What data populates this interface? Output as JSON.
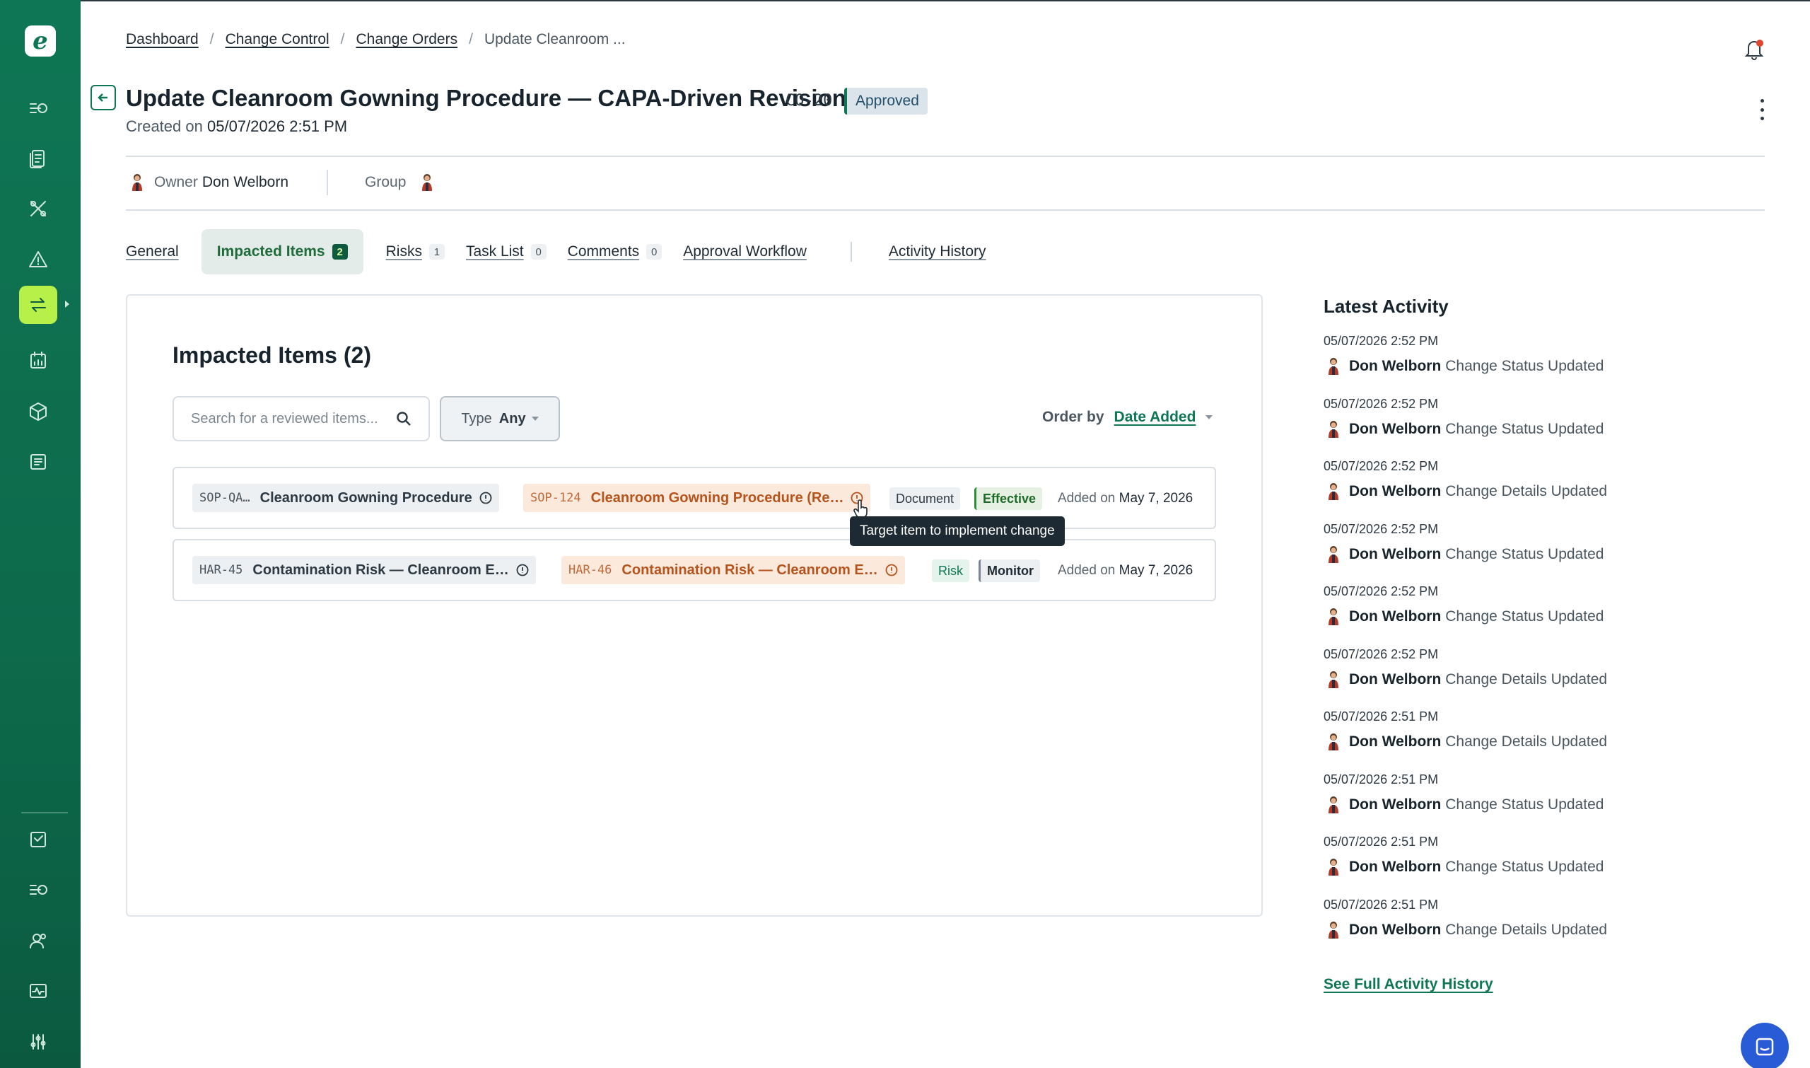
{
  "sidebar": {
    "logo": "e",
    "items": [
      {
        "icon": "workflow-icon"
      },
      {
        "icon": "documents-icon"
      },
      {
        "icon": "tools-icon"
      },
      {
        "icon": "warning-icon"
      },
      {
        "icon": "change-control-icon",
        "active": true
      },
      {
        "icon": "calendar-chart-icon"
      },
      {
        "icon": "box-icon"
      },
      {
        "icon": "ledger-icon"
      }
    ],
    "bottom_items": [
      {
        "icon": "inbox-icon"
      },
      {
        "icon": "tasks-icon"
      },
      {
        "icon": "users-icon"
      },
      {
        "icon": "monitor-icon"
      },
      {
        "icon": "sliders-icon"
      }
    ]
  },
  "breadcrumb": {
    "items": [
      "Dashboard",
      "Change Control",
      "Change Orders"
    ],
    "current": "Update Cleanroom ..."
  },
  "header": {
    "title": "Update Cleanroom Gowning Procedure — CAPA-Driven Revision",
    "code": "CO-20",
    "status": "Approved",
    "created_label": "Created on",
    "created_value": "05/07/2026 2:51 PM"
  },
  "meta": {
    "owner_label": "Owner",
    "owner_name": "Don Welborn",
    "group_label": "Group"
  },
  "tabs": [
    {
      "label": "General"
    },
    {
      "label": "Impacted Items",
      "count": "2",
      "active": true
    },
    {
      "label": "Risks",
      "count": "1"
    },
    {
      "label": "Task List",
      "count": "0"
    },
    {
      "label": "Comments",
      "count": "0"
    },
    {
      "label": "Approval Workflow"
    },
    {
      "label": "Activity History"
    }
  ],
  "impacted": {
    "title": "Impacted Items (2)",
    "search_placeholder": "Search for a reviewed items...",
    "type_label": "Type",
    "type_value": "Any",
    "order_label": "Order by",
    "order_value": "Date Added",
    "added_label": "Added on",
    "rows": [
      {
        "src_id": "SOP-QA…",
        "src_name": "Cleanroom Gowning Procedure",
        "tgt_id": "SOP-124",
        "tgt_name": "Cleanroom Gowning Procedure (Re…",
        "type": "Document",
        "state": "Effective",
        "added": "May 7, 2026"
      },
      {
        "src_id": "HAR-45",
        "src_name": "Contamination Risk — Cleanroom E…",
        "tgt_id": "HAR-46",
        "tgt_name": "Contamination Risk — Cleanroom E…",
        "type": "Risk",
        "state": "Monitor",
        "added": "May 7, 2026"
      }
    ],
    "tooltip": "Target item to implement change"
  },
  "activity": {
    "title": "Latest Activity",
    "items": [
      {
        "time": "05/07/2026 2:52 PM",
        "user": "Don Welborn",
        "action": "Change Status Updated"
      },
      {
        "time": "05/07/2026 2:52 PM",
        "user": "Don Welborn",
        "action": "Change Status Updated"
      },
      {
        "time": "05/07/2026 2:52 PM",
        "user": "Don Welborn",
        "action": "Change Details Updated"
      },
      {
        "time": "05/07/2026 2:52 PM",
        "user": "Don Welborn",
        "action": "Change Status Updated"
      },
      {
        "time": "05/07/2026 2:52 PM",
        "user": "Don Welborn",
        "action": "Change Status Updated"
      },
      {
        "time": "05/07/2026 2:52 PM",
        "user": "Don Welborn",
        "action": "Change Details Updated"
      },
      {
        "time": "05/07/2026 2:51 PM",
        "user": "Don Welborn",
        "action": "Change Details Updated"
      },
      {
        "time": "05/07/2026 2:51 PM",
        "user": "Don Welborn",
        "action": "Change Status Updated"
      },
      {
        "time": "05/07/2026 2:51 PM",
        "user": "Don Welborn",
        "action": "Change Status Updated"
      },
      {
        "time": "05/07/2026 2:51 PM",
        "user": "Don Welborn",
        "action": "Change Details Updated"
      }
    ],
    "see_full": "See Full Activity History"
  },
  "colors": {
    "brand": "#0e7654",
    "accent": "#b8f04a",
    "target_chip": "#b6541e"
  }
}
